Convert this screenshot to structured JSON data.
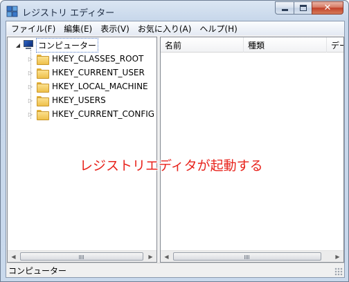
{
  "window": {
    "title": "レジストリ エディター"
  },
  "menu": [
    "ファイル(F)",
    "編集(E)",
    "表示(V)",
    "お気に入り(A)",
    "ヘルプ(H)"
  ],
  "tree": {
    "root": "コンピューター",
    "items": [
      "HKEY_CLASSES_ROOT",
      "HKEY_CURRENT_USER",
      "HKEY_LOCAL_MACHINE",
      "HKEY_USERS",
      "HKEY_CURRENT_CONFIG"
    ]
  },
  "list": {
    "columns": [
      "名前",
      "種類",
      "デー"
    ]
  },
  "status": "コンピューター",
  "annotation": "レジストリエディタが起動する",
  "colors": {
    "annotation": "#e8231c",
    "close_button": "#c2412a",
    "folder": "#eec04a"
  },
  "icons": {
    "app": "registry-editor-icon",
    "root": "computer-icon",
    "keys": "folder-icon"
  }
}
